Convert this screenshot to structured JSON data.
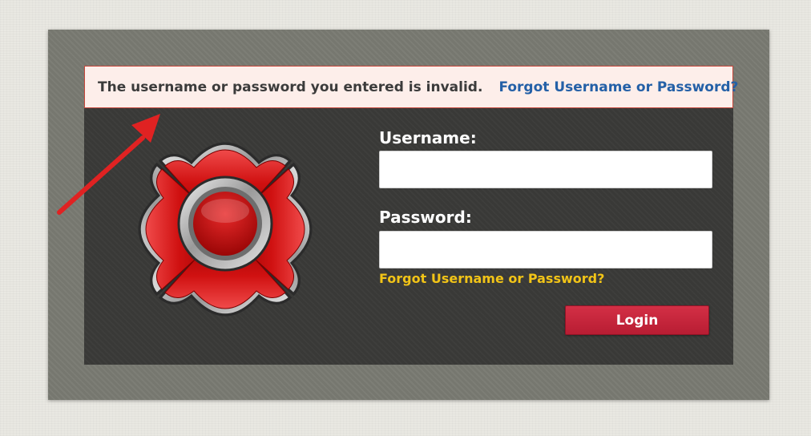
{
  "error": {
    "message": "The username or password you entered is invalid.",
    "link_label": "Forgot Username or Password?"
  },
  "form": {
    "username_label": "Username:",
    "username_value": "",
    "password_label": "Password:",
    "password_value": "",
    "forgot_label": "Forgot Username or Password?",
    "login_label": "Login"
  },
  "icons": {
    "logo": "maltese-cross-logo-icon",
    "annotation": "red-arrow-annotation-icon"
  },
  "colors": {
    "error_link": "#2460a7",
    "forgot_link": "#f2c417",
    "login_button": "#c8283d",
    "error_border": "#c6463a",
    "error_bg": "#fdeeea",
    "panel_dark": "#393937",
    "panel_outer": "#76776f"
  }
}
